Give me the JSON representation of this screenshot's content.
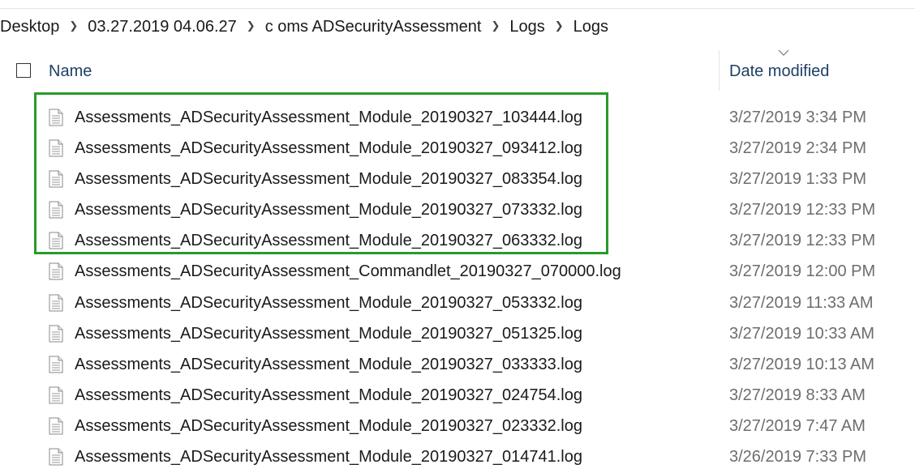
{
  "breadcrumb": {
    "items": [
      "Desktop",
      "03.27.2019 04.06.27",
      "c  oms ADSecurityAssessment",
      "Logs",
      "Logs"
    ]
  },
  "columns": {
    "name": "Name",
    "date_modified": "Date modified"
  },
  "files": [
    {
      "name": "Assessments_ADSecurityAssessment_Module_20190327_103444.log",
      "date": "3/27/2019 3:34 PM",
      "highlighted": true
    },
    {
      "name": "Assessments_ADSecurityAssessment_Module_20190327_093412.log",
      "date": "3/27/2019 2:34 PM",
      "highlighted": true
    },
    {
      "name": "Assessments_ADSecurityAssessment_Module_20190327_083354.log",
      "date": "3/27/2019 1:33 PM",
      "highlighted": true
    },
    {
      "name": "Assessments_ADSecurityAssessment_Module_20190327_073332.log",
      "date": "3/27/2019 12:33 PM",
      "highlighted": true
    },
    {
      "name": "Assessments_ADSecurityAssessment_Module_20190327_063332.log",
      "date": "3/27/2019 12:33 PM",
      "highlighted": true
    },
    {
      "name": "Assessments_ADSecurityAssessment_Commandlet_20190327_070000.log",
      "date": "3/27/2019 12:00 PM",
      "highlighted": false
    },
    {
      "name": "Assessments_ADSecurityAssessment_Module_20190327_053332.log",
      "date": "3/27/2019 11:33 AM",
      "highlighted": false
    },
    {
      "name": "Assessments_ADSecurityAssessment_Module_20190327_051325.log",
      "date": "3/27/2019 10:33 AM",
      "highlighted": false
    },
    {
      "name": "Assessments_ADSecurityAssessment_Module_20190327_033333.log",
      "date": "3/27/2019 10:13 AM",
      "highlighted": false
    },
    {
      "name": "Assessments_ADSecurityAssessment_Module_20190327_024754.log",
      "date": "3/27/2019 8:33 AM",
      "highlighted": false
    },
    {
      "name": "Assessments_ADSecurityAssessment_Module_20190327_023332.log",
      "date": "3/27/2019 7:47 AM",
      "highlighted": false
    },
    {
      "name": "Assessments_ADSecurityAssessment_Module_20190327_014741.log",
      "date": "3/26/2019 7:33 PM",
      "highlighted": false
    }
  ],
  "icons": {
    "file": "document-icon",
    "separator": "chevron-right-icon",
    "sort": "chevron-down-icon"
  },
  "colors": {
    "highlight_border": "#2a9a2a",
    "header_text": "#1f3f66",
    "date_text": "#6d6d6d"
  }
}
